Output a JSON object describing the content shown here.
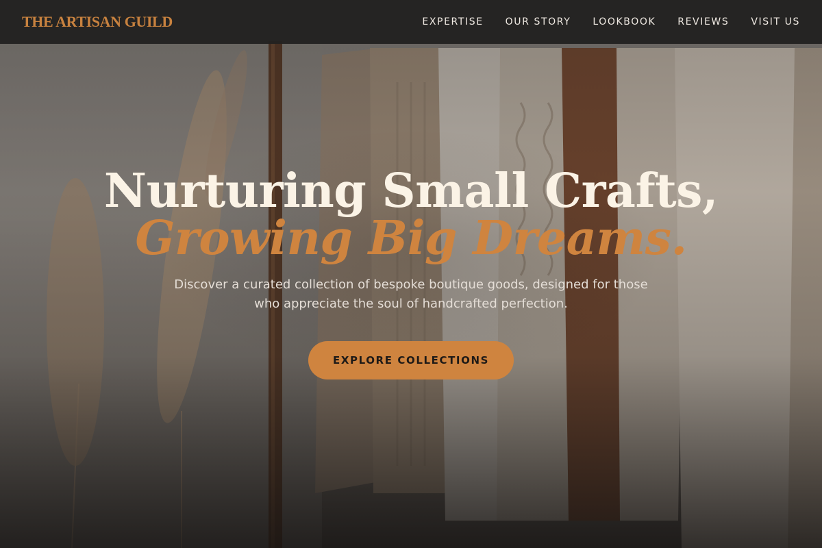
{
  "brand": {
    "name": "THE ARTISAN GUILD",
    "accent_color": "#cf843f"
  },
  "nav": {
    "items": [
      {
        "label": "EXPERTISE"
      },
      {
        "label": "OUR STORY"
      },
      {
        "label": "LOOKBOOK"
      },
      {
        "label": "REVIEWS"
      },
      {
        "label": "VISIT US"
      }
    ]
  },
  "hero": {
    "headline_line1": "Nurturing Small Crafts,",
    "headline_line2": "Growing Big Dreams.",
    "subtitle": "Discover a curated collection of bespoke boutique goods, designed for those who appreciate the soul of handcrafted perfection.",
    "cta_label": "EXPLORE COLLECTIONS",
    "background_image": "clothing-rack-with-knit-sweaters-and-pampas-grass"
  }
}
